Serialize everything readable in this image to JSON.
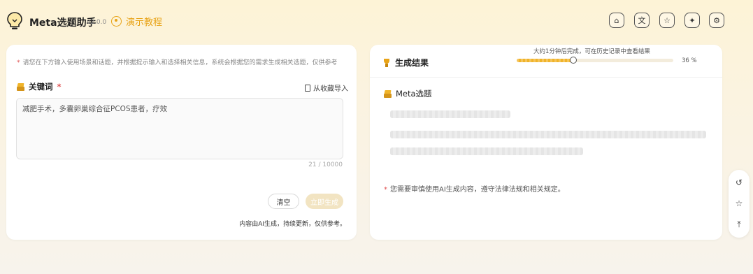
{
  "header": {
    "app_title": "Meta选题助手",
    "version": "v2.0.0",
    "tutorial_label": "演示教程",
    "icons": [
      "home-icon",
      "translate-icon",
      "star-icon",
      "ai-assistant-icon",
      "settings-icon"
    ]
  },
  "input_panel": {
    "notice": "请您在下方输入使用场景和话题，并根据提示输入和选择相关信息，系统会根据您的需求生成相关选题，仅供参考",
    "keyword_label": "关键词",
    "required_mark": "*",
    "import_label": "从收藏导入",
    "keyword_value": "减肥手术，多囊卵巢综合征PCOS患者，疗效",
    "counter": "21 / 10000",
    "clear_label": "清空",
    "generate_label": "立即生成",
    "ai_note": "内容由AI生成，持续更新，仅供参考。"
  },
  "result_panel": {
    "title": "生成结果",
    "progress_text": "大约1分钟后完成，可在历史记录中查看结果",
    "progress_percent": 36,
    "progress_label": "36 %",
    "section_title": "Meta选题",
    "disclaimer": "您需要审慎使用AI生成内容，遵守法律法规和相关规定。"
  },
  "side_tools": [
    "history-icon",
    "favorite-icon",
    "back-to-top-icon"
  ],
  "colors": {
    "accent": "#e8a317",
    "required": "#e05050",
    "background_top": "#fdf3d6"
  }
}
